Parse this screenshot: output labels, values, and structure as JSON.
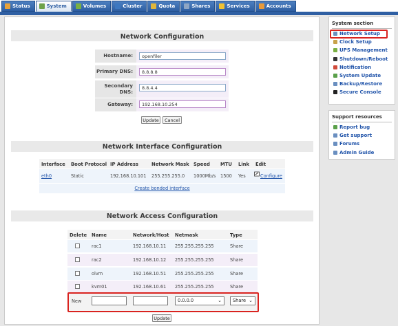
{
  "tabs": [
    {
      "label": "Status",
      "icon": "status-icon",
      "color": "#e8a23a"
    },
    {
      "label": "System",
      "icon": "system-icon",
      "color": "#6fa24a"
    },
    {
      "label": "Volumes",
      "icon": "volumes-icon",
      "color": "#7ab043"
    },
    {
      "label": "Cluster",
      "icon": "cluster-icon",
      "color": "#3d78c0"
    },
    {
      "label": "Quota",
      "icon": "quota-icon",
      "color": "#e0b63a"
    },
    {
      "label": "Shares",
      "icon": "shares-icon",
      "color": "#8fa6c4"
    },
    {
      "label": "Services",
      "icon": "services-icon",
      "color": "#f1c232"
    },
    {
      "label": "Accounts",
      "icon": "accounts-icon",
      "color": "#e89a3a"
    }
  ],
  "active_tab": "System",
  "network_config": {
    "title": "Network Configuration",
    "hostname_label": "Hostname:",
    "hostname_value": "openfiler",
    "primary_dns_label": "Primary DNS:",
    "primary_dns_value": "8.8.8.8",
    "secondary_dns_label": "Secondary DNS:",
    "secondary_dns_value": "8.8.4.4",
    "gateway_label": "Gateway:",
    "gateway_value": "192.168.10.254",
    "update_label": "Update",
    "cancel_label": "Cancel"
  },
  "interface_config": {
    "title": "Network Interface Configuration",
    "headers": [
      "Interface",
      "Boot Protocol",
      "IP Address",
      "Network Mask",
      "Speed",
      "MTU",
      "Link",
      "Edit"
    ],
    "rows": [
      {
        "interface": "eth0",
        "boot": "Static",
        "ip": "192.168.10.101",
        "mask": "255.255.255.0",
        "speed": "1000Mb/s",
        "mtu": "1500",
        "link": "Yes",
        "edit": "Configure"
      }
    ],
    "bonded_link": "Create bonded interface"
  },
  "access_config": {
    "title": "Network Access Configuration",
    "headers": [
      "Delete",
      "Name",
      "Network/Host",
      "Netmask",
      "Type"
    ],
    "rows": [
      {
        "name": "rac1",
        "host": "192.168.10.11",
        "mask": "255.255.255.255",
        "type": "Share"
      },
      {
        "name": "rac2",
        "host": "192.168.10.12",
        "mask": "255.255.255.255",
        "type": "Share"
      },
      {
        "name": "olvm",
        "host": "192.168.10.51",
        "mask": "255.255.255.255",
        "type": "Share"
      },
      {
        "name": "kvm01",
        "host": "192.168.10.61",
        "mask": "255.255.255.255",
        "type": "Share"
      }
    ],
    "new_label": "New",
    "new_name": "",
    "new_host": "",
    "new_netmask": "0.0.0.0",
    "new_type": "Share",
    "update_label": "Update"
  },
  "sidebar": {
    "system_title": "System section",
    "system_items": [
      {
        "label": "Network Setup",
        "icon": "network-setup-icon",
        "color": "#6a8fc0"
      },
      {
        "label": "Clock Setup",
        "icon": "clock-icon",
        "color": "#c8a24a"
      },
      {
        "label": "UPS Management",
        "icon": "ups-icon",
        "color": "#7ab043"
      },
      {
        "label": "Shutdown/Reboot",
        "icon": "shutdown-icon",
        "color": "#333333"
      },
      {
        "label": "Notification",
        "icon": "notification-icon",
        "color": "#d04a3a"
      },
      {
        "label": "System Update",
        "icon": "system-update-icon",
        "color": "#5aa04a"
      },
      {
        "label": "Backup/Restore",
        "icon": "backup-icon",
        "color": "#6a8fc0"
      },
      {
        "label": "Secure Console",
        "icon": "console-icon",
        "color": "#222222"
      }
    ],
    "support_title": "Support resources",
    "support_items": [
      {
        "label": "Report bug",
        "icon": "bug-icon",
        "color": "#5aa04a"
      },
      {
        "label": "Get support",
        "icon": "support-icon",
        "color": "#6a8fc0"
      },
      {
        "label": "Forums",
        "icon": "forums-icon",
        "color": "#6a8fc0"
      },
      {
        "label": "Admin Guide",
        "icon": "guide-icon",
        "color": "#6a8fc0"
      }
    ]
  },
  "highlight_color": "#d9231f"
}
